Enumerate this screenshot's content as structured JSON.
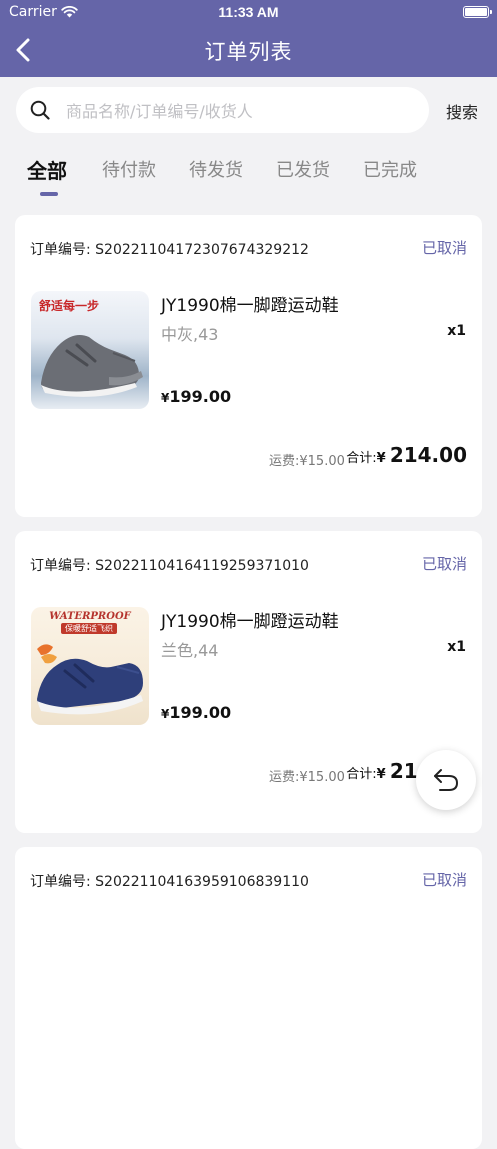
{
  "status_bar": {
    "carrier": "Carrier",
    "time": "11:33 AM"
  },
  "header": {
    "title": "订单列表"
  },
  "search": {
    "placeholder": "商品名称/订单编号/收货人",
    "button_label": "搜索"
  },
  "tabs": [
    {
      "label": "全部",
      "active": true
    },
    {
      "label": "待付款"
    },
    {
      "label": "待发货"
    },
    {
      "label": "已发货"
    },
    {
      "label": "已完成"
    }
  ],
  "orders": [
    {
      "order_label": "订单编号: S20221104172307674329212",
      "status": "已取消",
      "image_text": "舒适每一步",
      "product_name": "JY1990棉一脚蹬运动鞋",
      "spec": "中灰,43",
      "qty": "x1",
      "price_symbol": "¥",
      "price": "199.00",
      "shipping": "运费:¥15.00",
      "total_label": "合计:",
      "total_symbol": "¥",
      "total_amount": "214.00"
    },
    {
      "order_label": "订单编号: S20221104164119259371010",
      "status": "已取消",
      "image_text": "WATERPROOF",
      "image_subtext": "保暖舒适飞织",
      "product_name": "JY1990棉一脚蹬运动鞋",
      "spec": "兰色,44",
      "qty": "x1",
      "price_symbol": "¥",
      "price": "199.00",
      "shipping": "运费:¥15.00",
      "total_label": "合计:",
      "total_symbol": "¥",
      "total_amount": "214.00"
    },
    {
      "order_label": "订单编号: S20221104163959106839110",
      "status": "已取消"
    }
  ],
  "colors": {
    "accent": "#6565a8",
    "background": "#f2f2f4"
  }
}
